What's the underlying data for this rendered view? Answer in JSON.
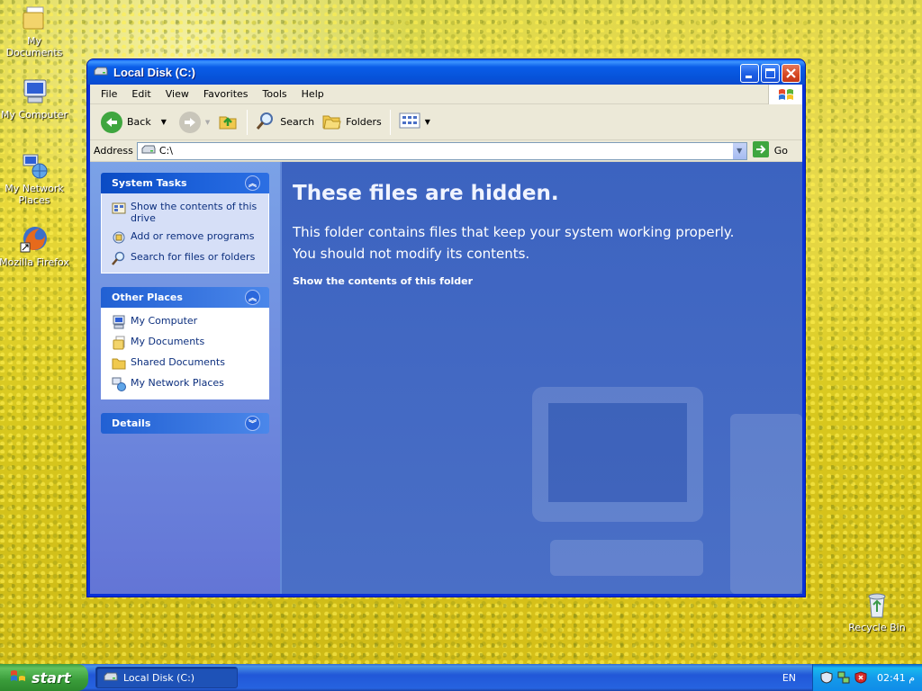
{
  "desktop": {
    "icons": [
      {
        "label": "My Documents"
      },
      {
        "label": "My Computer"
      },
      {
        "label": "My Network Places"
      },
      {
        "label": "Mozilla Firefox"
      },
      {
        "label": "Recycle Bin"
      }
    ]
  },
  "window": {
    "title": "Local Disk (C:)",
    "menu": [
      "File",
      "Edit",
      "View",
      "Favorites",
      "Tools",
      "Help"
    ],
    "toolbar": {
      "back": "Back",
      "search": "Search",
      "folders": "Folders"
    },
    "address": {
      "label": "Address",
      "value": "C:\\",
      "go": "Go"
    },
    "left_pane": {
      "system_tasks": {
        "title": "System Tasks",
        "items": [
          "Show the contents of this drive",
          "Add or remove programs",
          "Search for files or folders"
        ]
      },
      "other_places": {
        "title": "Other Places",
        "items": [
          "My Computer",
          "My Documents",
          "Shared Documents",
          "My Network Places"
        ]
      },
      "details": {
        "title": "Details"
      }
    },
    "main": {
      "heading": "These files are hidden.",
      "message_line1": "This folder contains files that keep your system working properly.",
      "message_line2": "You should not modify its contents.",
      "show_link": "Show the contents of this folder"
    }
  },
  "taskbar": {
    "start": "start",
    "task_button": "Local Disk (C:)",
    "language": "EN",
    "clock": "02:41 م"
  },
  "colors": {
    "xp_blue": "#0831d9",
    "start_green": "#3a9c3a",
    "hidden_pane": "#4369c2"
  }
}
